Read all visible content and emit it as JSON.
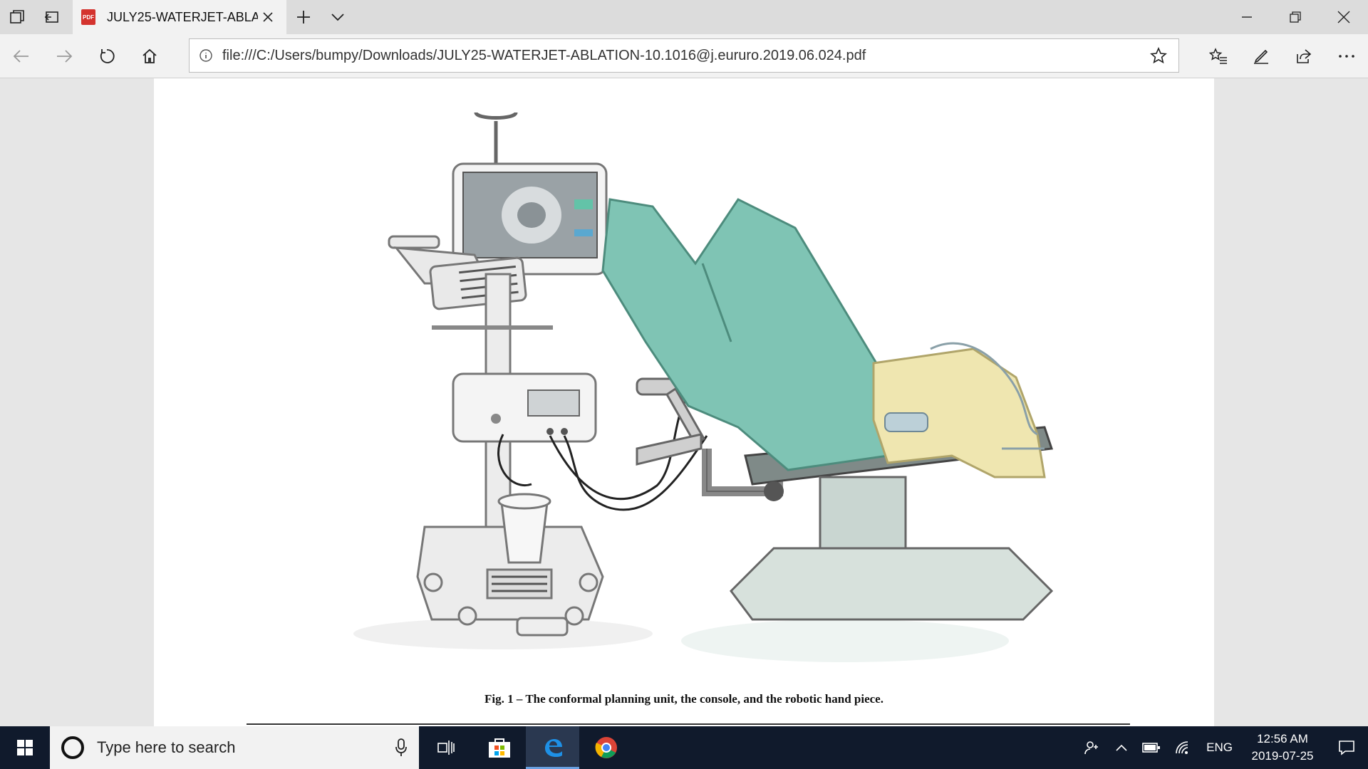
{
  "browser": {
    "tab": {
      "title": "JULY25-WATERJET-ABLA",
      "favicon": "pdf-icon"
    },
    "address_url": "file:///C:/Users/bumpy/Downloads/JULY25-WATERJET-ABLATION-10.1016@j.eururo.2019.06.024.pdf",
    "icons": [
      "tab-manager-icon",
      "set-aside-tabs-icon",
      "close-icon",
      "plus-icon",
      "chevron-down-icon",
      "minimize-icon",
      "restore-icon",
      "back-icon",
      "forward-icon",
      "refresh-icon",
      "home-icon",
      "info-icon",
      "star-icon",
      "favorites-icon",
      "pen-icon",
      "share-icon",
      "more-icon"
    ]
  },
  "document": {
    "caption": "Fig. 1 – The conformal planning unit, the console, and the robotic hand piece."
  },
  "taskbar": {
    "search_placeholder": "Type here to search",
    "language": "ENG",
    "time": "12:56 AM",
    "date": "2019-07-25"
  },
  "colors": {
    "taskbar_bg": "#101a2c",
    "drape": "#7fc4b4",
    "blanket": "#efe6b0"
  }
}
